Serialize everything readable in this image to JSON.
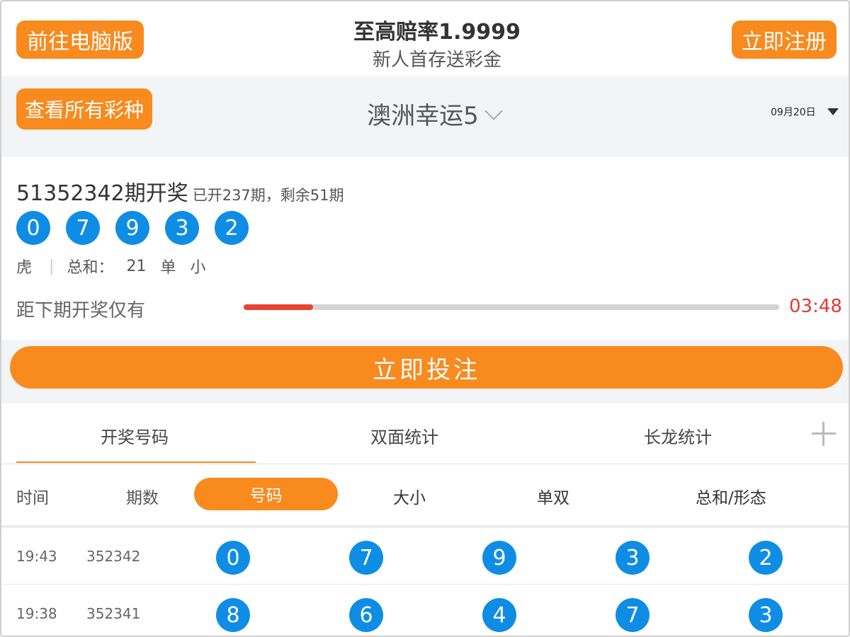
{
  "header": {
    "desktop_label": "前往电脑版",
    "title": "至高赔率1.9999",
    "subtitle": "新人首存送彩金",
    "register_label": "立即注册"
  },
  "lottery_bar": {
    "all_label": "查看所有彩种",
    "lottery_name": "澳洲幸运5",
    "date": "09月20日"
  },
  "draw": {
    "period_title": "51352342期开奖",
    "period_info": "已开237期，剩余51期",
    "numbers": [
      "0",
      "7",
      "9",
      "3",
      "2"
    ],
    "dragon_tiger": "虎",
    "sum_label": "总和：",
    "sum_value": "21",
    "odd_even": "单",
    "big_small": "小",
    "countdown_label": "距下期开奖仅有",
    "countdown_time": "03:48",
    "progress_fraction": 0.13
  },
  "bet_label": "立即投注",
  "tabs": [
    "开奖号码",
    "双面统计",
    "长龙统计"
  ],
  "subtabs": {
    "time": "时间",
    "issue": "期数",
    "numbers": "号码",
    "big_small": "大小",
    "odd_even": "单双",
    "sum_shape": "总和/形态"
  },
  "rows": [
    {
      "time": "19:43",
      "issue": "352342",
      "numbers": [
        "0",
        "7",
        "9",
        "3",
        "2"
      ]
    },
    {
      "time": "19:38",
      "issue": "352341",
      "numbers": [
        "8",
        "6",
        "4",
        "7",
        "3"
      ]
    }
  ],
  "colors": {
    "accent_orange": "#f88a1e",
    "ball_blue": "#0f8de5",
    "countdown_red": "#e53935",
    "progress_red": "#e84430"
  }
}
